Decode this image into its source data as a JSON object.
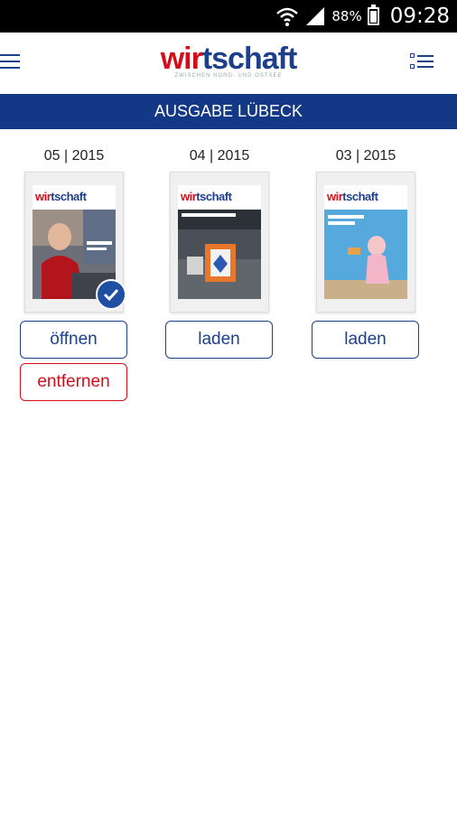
{
  "status_bar": {
    "battery": "88%",
    "time": "09:28"
  },
  "header": {
    "logo_part1": "wir",
    "logo_part2": "tschaft",
    "logo_tagline": "ZWISCHEN NORD- UND OSTSEE"
  },
  "banner": {
    "title": "AUSGABE LÜBECK"
  },
  "issues": [
    {
      "date": "05 | 2015",
      "cover_logo_1": "wir",
      "cover_logo_2": "tschaft",
      "downloaded": true,
      "primary_label": "öffnen",
      "remove_label": "entfernen"
    },
    {
      "date": "04 | 2015",
      "cover_logo_1": "wir",
      "cover_logo_2": "tschaft",
      "downloaded": false,
      "primary_label": "laden"
    },
    {
      "date": "03 | 2015",
      "cover_logo_1": "wir",
      "cover_logo_2": "tschaft",
      "downloaded": false,
      "primary_label": "laden"
    }
  ],
  "colors": {
    "brand_blue": "#133885",
    "brand_red": "#d40d1b"
  },
  "icons": {
    "menu": "hamburger-icon",
    "list": "list-view-icon",
    "downloaded": "check-circle-icon",
    "wifi": "wifi-icon",
    "signal": "signal-icon",
    "battery": "battery-icon"
  }
}
